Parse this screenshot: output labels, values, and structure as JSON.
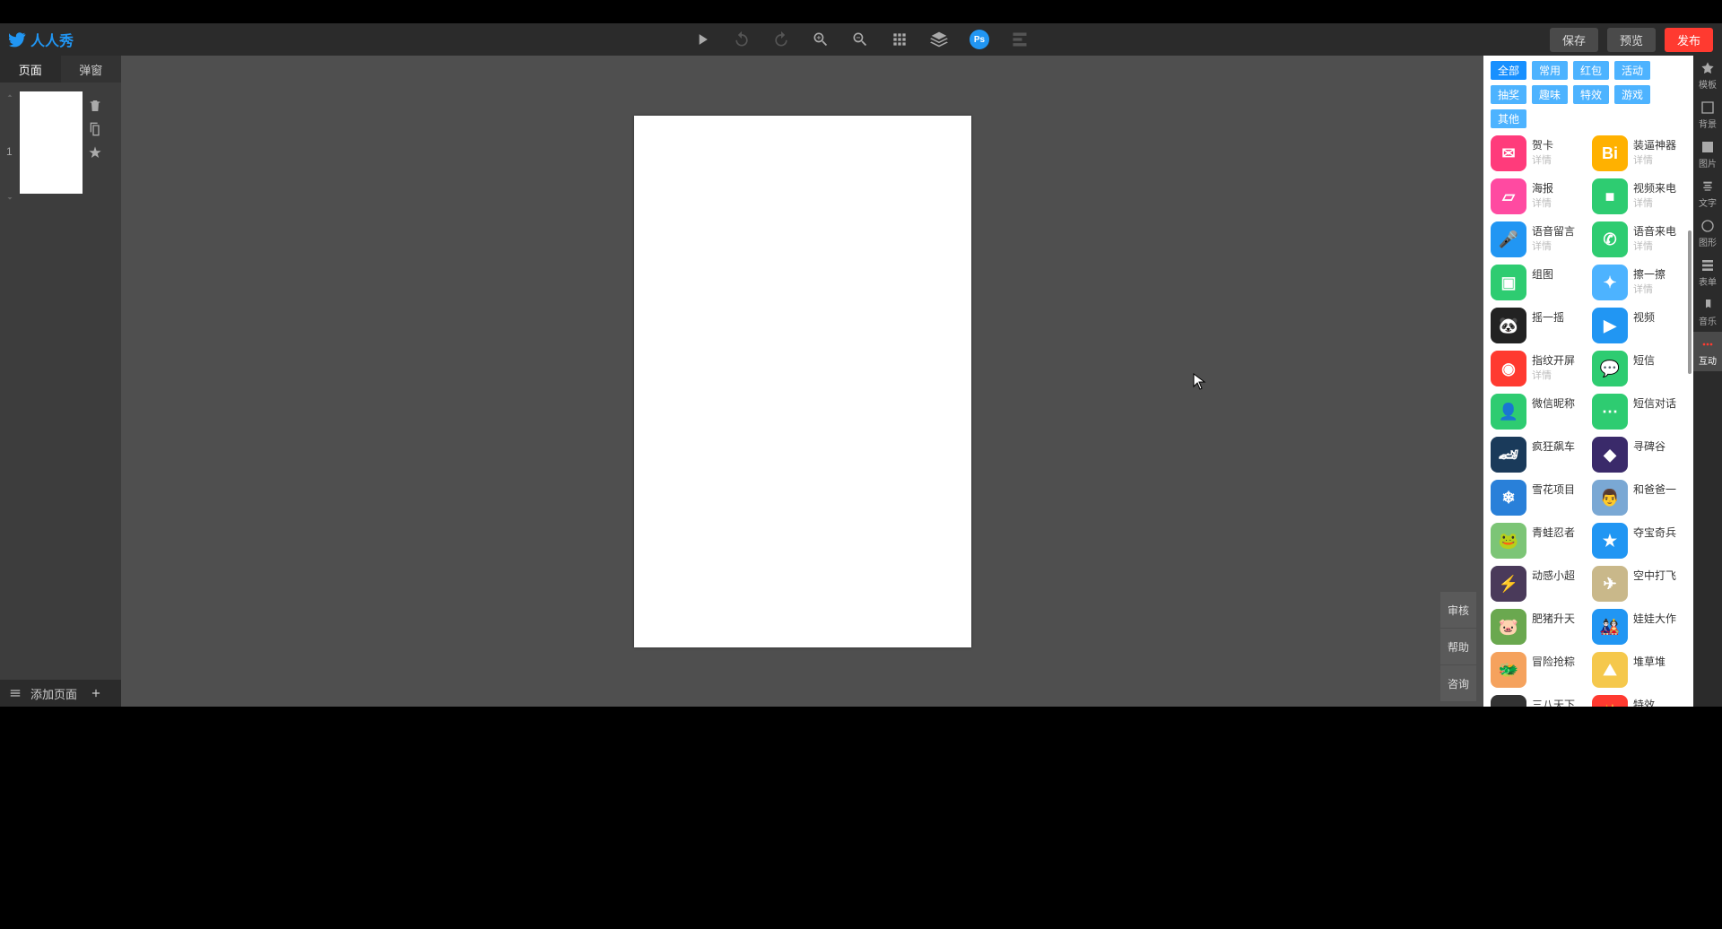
{
  "brand": "人人秀",
  "topbar": {
    "save": "保存",
    "preview": "预览",
    "publish": "发布"
  },
  "leftTabs": {
    "page": "页面",
    "popup": "弹窗"
  },
  "pageNumber": "1",
  "addPage": "添加页面",
  "filters": [
    "全部",
    "常用",
    "红包",
    "活动",
    "抽奖",
    "趣味",
    "特效",
    "游戏",
    "其他"
  ],
  "activeFilter": "全部",
  "sideTools": [
    {
      "label": "模板"
    },
    {
      "label": "背景"
    },
    {
      "label": "图片"
    },
    {
      "label": "文字"
    },
    {
      "label": "图形"
    },
    {
      "label": "表单"
    },
    {
      "label": "音乐"
    },
    {
      "label": "互动"
    }
  ],
  "aux": [
    "审核",
    "帮助",
    "咨询"
  ],
  "detailText": "详情",
  "components": [
    {
      "title": "贺卡",
      "detail": true,
      "bg": "#ff3b7b",
      "glyph": "✉"
    },
    {
      "title": "装逼神器",
      "detail": true,
      "bg": "#ffb100",
      "glyph": "Bi"
    },
    {
      "title": "海报",
      "detail": true,
      "bg": "#ff4aa1",
      "glyph": "▱"
    },
    {
      "title": "视频来电",
      "detail": true,
      "bg": "#2ecc71",
      "glyph": "■"
    },
    {
      "title": "语音留言",
      "detail": true,
      "bg": "#2196f3",
      "glyph": "🎤"
    },
    {
      "title": "语音来电",
      "detail": true,
      "bg": "#2ecc71",
      "glyph": "✆"
    },
    {
      "title": "组图",
      "detail": false,
      "bg": "#2ecc71",
      "glyph": "▣"
    },
    {
      "title": "擦一擦",
      "detail": true,
      "bg": "#4db3ff",
      "glyph": "✦"
    },
    {
      "title": "摇一摇",
      "detail": false,
      "bg": "#222",
      "glyph": "🐼"
    },
    {
      "title": "视频",
      "detail": false,
      "bg": "#2196f3",
      "glyph": "▶"
    },
    {
      "title": "指纹开屏",
      "detail": true,
      "bg": "#ff3a30",
      "glyph": "◉"
    },
    {
      "title": "短信",
      "detail": false,
      "bg": "#2ecc71",
      "glyph": "💬"
    },
    {
      "title": "微信昵称",
      "detail": false,
      "bg": "#2ecc71",
      "glyph": "👤"
    },
    {
      "title": "短信对话",
      "detail": false,
      "bg": "#2ecc71",
      "glyph": "⋯"
    },
    {
      "title": "疯狂飙车",
      "detail": false,
      "bg": "#1a3a5a",
      "glyph": "🏎"
    },
    {
      "title": "寻碑谷",
      "detail": false,
      "bg": "#3a2a6a",
      "glyph": "◆"
    },
    {
      "title": "雪花项目",
      "detail": false,
      "bg": "#2980d9",
      "glyph": "❄"
    },
    {
      "title": "和爸爸一",
      "detail": false,
      "bg": "#7aa8d4",
      "glyph": "👨"
    },
    {
      "title": "青蛙忍者",
      "detail": false,
      "bg": "#7cc576",
      "glyph": "🐸"
    },
    {
      "title": "夺宝奇兵",
      "detail": false,
      "bg": "#2196f3",
      "glyph": "★"
    },
    {
      "title": "动感小超",
      "detail": false,
      "bg": "#4a3a5a",
      "glyph": "⚡"
    },
    {
      "title": "空中打飞",
      "detail": false,
      "bg": "#c9b88a",
      "glyph": "✈"
    },
    {
      "title": "肥猪升天",
      "detail": false,
      "bg": "#6aa84f",
      "glyph": "🐷"
    },
    {
      "title": "娃娃大作",
      "detail": false,
      "bg": "#2196f3",
      "glyph": "🎎"
    },
    {
      "title": "冒险抢粽",
      "detail": false,
      "bg": "#f5a25d",
      "glyph": "🐲"
    },
    {
      "title": "堆草堆",
      "detail": false,
      "bg": "#f5c84c",
      "glyph": "⛰"
    },
    {
      "title": "三八天下",
      "detail": false,
      "bg": "#333",
      "glyph": "…"
    },
    {
      "title": "特效",
      "detail": false,
      "bg": "#ff3a30",
      "glyph": "✨"
    }
  ]
}
